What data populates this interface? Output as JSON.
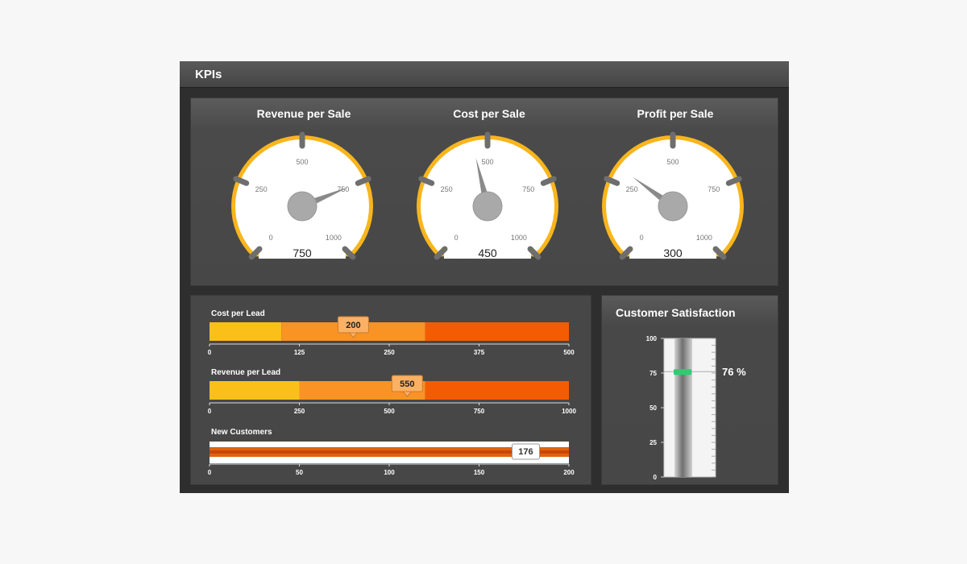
{
  "header": {
    "title": "KPIs"
  },
  "gauges": [
    {
      "title": "Revenue per Sale",
      "value": 750,
      "display": "750",
      "min": 0,
      "max": 1000,
      "ticks": [
        "0",
        "250",
        "500",
        "750",
        "1000"
      ]
    },
    {
      "title": "Cost per Sale",
      "value": 450,
      "display": "450",
      "min": 0,
      "max": 1000,
      "ticks": [
        "0",
        "250",
        "500",
        "750",
        "1000"
      ]
    },
    {
      "title": "Profit per Sale",
      "value": 300,
      "display": "300",
      "min": 0,
      "max": 1000,
      "ticks": [
        "0",
        "250",
        "500",
        "750",
        "1000"
      ]
    }
  ],
  "bullets": [
    {
      "title": "Cost per Lead",
      "min": 0,
      "max": 500,
      "value": 200,
      "marker_label": "200",
      "bands": [
        {
          "to": 100,
          "color": "#fbbf19"
        },
        {
          "to": 300,
          "color": "#f99324"
        },
        {
          "to": 500,
          "color": "#f45c04"
        }
      ],
      "ticks": [
        "0",
        "125",
        "250",
        "375",
        "500"
      ]
    },
    {
      "title": "Revenue per Lead",
      "min": 0,
      "max": 1000,
      "value": 550,
      "marker_label": "550",
      "bands": [
        {
          "to": 250,
          "color": "#fbbf19"
        },
        {
          "to": 600,
          "color": "#f99324"
        },
        {
          "to": 1000,
          "color": "#f45c04"
        }
      ],
      "ticks": [
        "0",
        "250",
        "500",
        "750",
        "1000"
      ]
    },
    {
      "title": "New Customers",
      "min": 0,
      "max": 200,
      "value": 176,
      "marker_label": "176",
      "ticks": [
        "0",
        "50",
        "100",
        "150",
        "200"
      ]
    }
  ],
  "satisfaction": {
    "title": "Customer Satisfaction",
    "value": 76,
    "value_label": "76 %",
    "ticks": [
      "0",
      "25",
      "50",
      "75",
      "100"
    ]
  },
  "colors": {
    "gauge_ring": "#f8b51c",
    "gauge_face": "#ffffff",
    "needle": "#8a8a8a",
    "marker_green": "#2ecc71"
  }
}
